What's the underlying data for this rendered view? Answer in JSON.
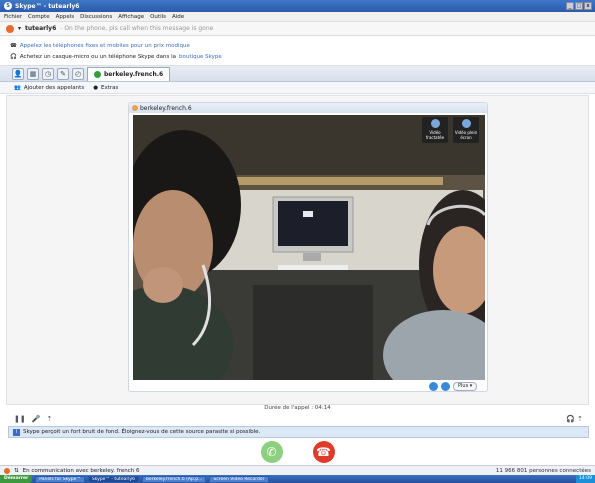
{
  "window": {
    "title": "Skype™ - tutearly6"
  },
  "menu": [
    "Fichier",
    "Compte",
    "Appels",
    "Discussions",
    "Affichage",
    "Outils",
    "Aide"
  ],
  "status": {
    "username": "tutearly6",
    "mood_placeholder": "- On the phone, pls call when this message is gone"
  },
  "promo": {
    "line1": "Appelez les téléphones fixes et mobiles pour un prix modique",
    "line2_prefix": "Achetez un casque-micro ou un téléphone Skype dans la",
    "line2_link": "boutique Skype"
  },
  "tab": {
    "label": "berkeley.french.6"
  },
  "toolbar": {
    "add_participants": "Ajouter des appelants",
    "extras": "Extras"
  },
  "video": {
    "caller": "berkeley.french.6",
    "btn_dock": "Vidéo fractatée",
    "btn_fullscreen": "Vidéo plein écran",
    "more": "Plus"
  },
  "call": {
    "duration": "Durée de l'appel : 04:14",
    "notice": "Skype perçoit un fort bruit de fond. Éloignez-vous de cette source parasite si possible."
  },
  "bottom": {
    "status_text": "En communication avec berkeley. french 6",
    "online_count": "11 966 801 personnes connectées"
  },
  "taskbar": {
    "start": "Démarrer",
    "items": [
      "Panels for Skype™",
      "Skype™ - tutearly6",
      "berkeley.french.6 (Ap.p...",
      "Screen Video Recorder"
    ],
    "clock": "14:09"
  },
  "colors": {
    "title": "#2b5aa8",
    "accept": "#8ccf7e",
    "hangup": "#e03a2a"
  }
}
